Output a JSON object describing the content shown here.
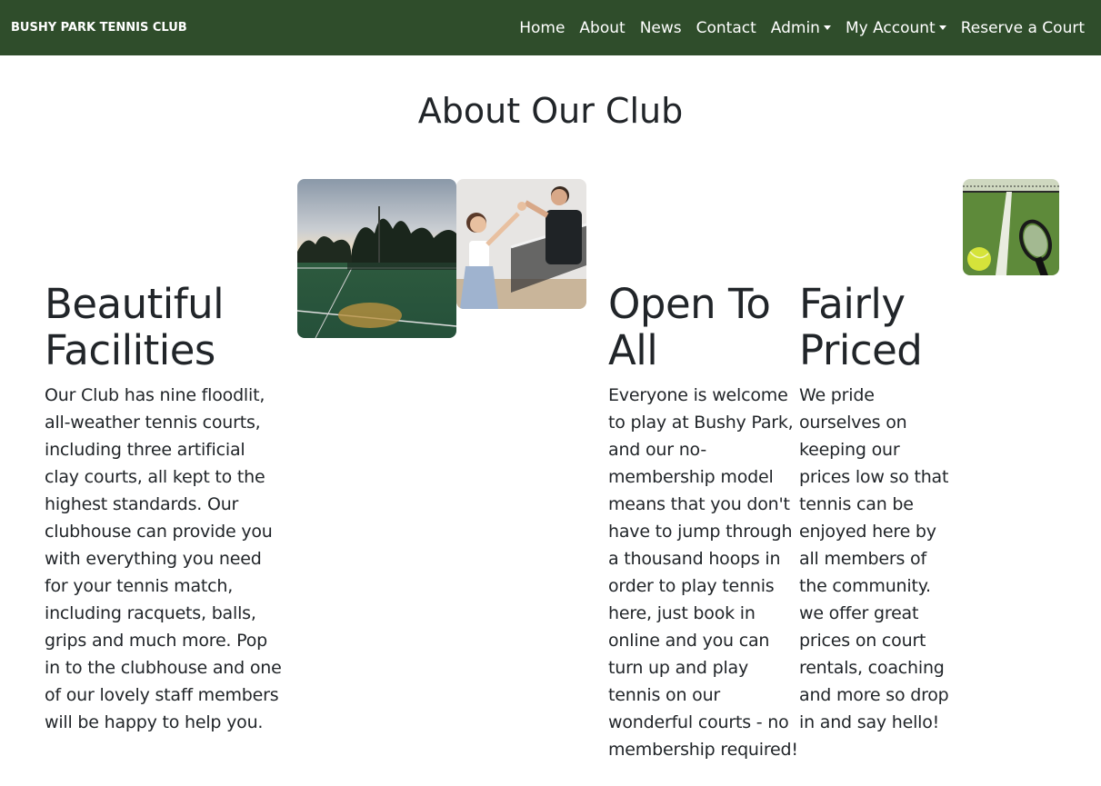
{
  "nav": {
    "brand": "BUSHY PARK TENNIS CLUB",
    "links": {
      "home": "Home",
      "about": "About",
      "news": "News",
      "contact": "Contact",
      "admin": "Admin",
      "account": "My Account",
      "reserve": "Reserve a Court"
    },
    "background": "#2f4d2b"
  },
  "page": {
    "title": "About Our Club"
  },
  "sections": [
    {
      "heading": "Beautiful Facilities",
      "body": "Our Club has nine floodlit, all-weather tennis courts, including three artificial clay courts, all kept to the highest standards. Our clubhouse can provide you with everything you need for your tennis match, including racquets, balls, grips and much more. Pop in to the clubhouse and one of our lovely staff members will be happy to help you."
    },
    {
      "heading": "Open To All",
      "body": "Everyone is welcome to play at Bushy Park, and our no-membership model means that you don't have to jump through a thousand hoops in order to play tennis here, just book in online and you can turn up and play tennis on our wonderful courts - no membership required!"
    },
    {
      "heading": "Fairly Priced",
      "body": "We pride ourselves on keeping our prices low so that tennis can be enjoyed here by all members of the community. we offer great prices on court rentals, coaching and more so drop in and say hello!"
    }
  ],
  "images": {
    "courts": "floodlit-courts-photo",
    "players": "players-high-five-photo",
    "ball": "ball-and-racquet-photo"
  }
}
